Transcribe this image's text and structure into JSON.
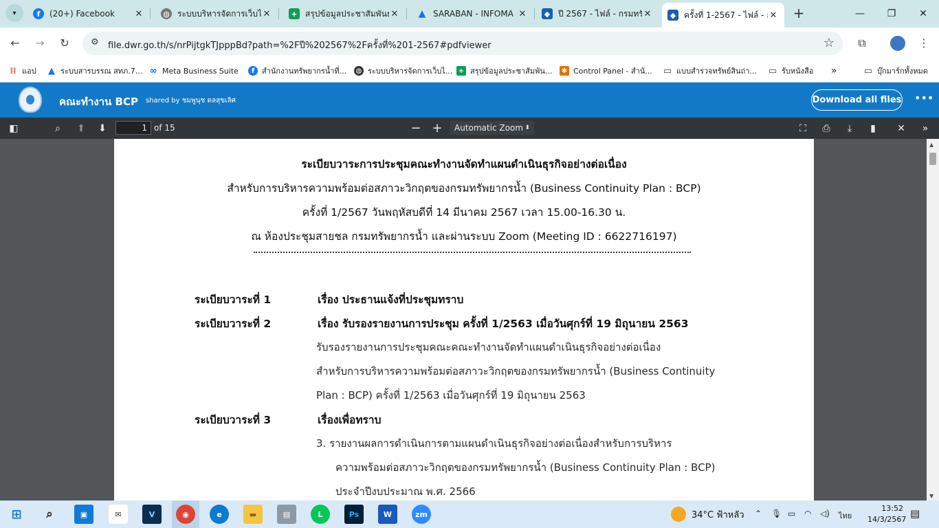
{
  "browser": {
    "tabs": [
      {
        "title": "(20+) Facebook",
        "icon": "facebook-icon",
        "color": "#1877f2"
      },
      {
        "title": "ระบบบริหารจัดการเว็บไซต์",
        "icon": "globe-icon",
        "color": "#555555"
      },
      {
        "title": "สรุปข้อมูลประชาสัมพันธ์",
        "icon": "sheets-icon",
        "color": "#0f9d58"
      },
      {
        "title": "SARABAN - INFOMA",
        "icon": "saraban-icon",
        "color": "#1a73e8"
      },
      {
        "title": "ปี 2567 - ไฟล์ - กรมทรัพย",
        "icon": "dropbox-icon",
        "color": "#1a5fb4"
      },
      {
        "title": "ครั้งที่ 1-2567 - ไฟล์ - กรม",
        "icon": "dropbox-icon",
        "color": "#1a5fb4"
      }
    ],
    "url": "file.dwr.go.th/s/nrPijtgkTJpppBd?path=%2F%E0%B8%9B%202567%2F%E0%B8%84%E0%B8%A3%E0%B8%B1%E0%B9%89%E0%B8%87%E0%B8%97%E0%B8%B5%E0%B9%88%201-2567#pdfviewer",
    "url_display": "file.dwr.go.th/s/nrPijtgkTJpppBd?path=%2Fปี%202567%2Fครั้งที่%201-2567#pdfviewer",
    "bookmarks": [
      {
        "label": "แอป",
        "icon": "apps-grid-icon",
        "color": "#ea4335"
      },
      {
        "label": "ระบบสารบรรณ สทภ.7...",
        "icon": "saraban-icon",
        "color": "#1a73e8"
      },
      {
        "label": "Meta Business Suite",
        "icon": "meta-icon",
        "color": "#0866ff"
      },
      {
        "label": "สำนักงานทรัพยากรน้ำที่...",
        "icon": "facebook-icon",
        "color": "#1877f2"
      },
      {
        "label": "ระบบบริหารจัดการเว็บไ...",
        "icon": "globe-icon",
        "color": "#333333"
      },
      {
        "label": "สรุปข้อมูลประชาสัมพัน...",
        "icon": "sheets-icon",
        "color": "#0f9d58"
      },
      {
        "label": "Control Panel - สำนั...",
        "icon": "control-panel-icon",
        "color": "#e37400"
      },
      {
        "label": "แบบสำรวจทรัพย์สินถ่า...",
        "icon": "folder-icon",
        "color": "#444444"
      },
      {
        "label": "รับหนังสือ",
        "icon": "folder-icon",
        "color": "#444444"
      },
      {
        "label": "บุ๊กมาร์กทั้งหมด",
        "icon": "folder-icon",
        "color": "#444444"
      }
    ]
  },
  "app": {
    "title": "คณะทำงาน BCP",
    "shared_by": "shared by ชมพูนุช ดลสุขเลิศ",
    "download_label": "Download all files"
  },
  "pdf": {
    "page": "1",
    "of_pages": "of 15",
    "zoom": "Automatic Zoom",
    "lines": {
      "h1": "ระเบียบวาระการประชุมคณะทำงานจัดทำแผนดำเนินธุรกิจอย่างต่อเนื่อง",
      "h2": "สำหรับการบริหารความพร้อมต่อสภาวะวิกฤตของกรมทรัพยากรน้ำ (Business Continuity Plan : BCP)",
      "h3": "ครั้งที่ 1/2567 วันพฤหัสบดีที่ 14 มีนาคม 2567 เวลา 15.00-16.30 น.",
      "h4": "ณ ห้องประชุมสายชล กรมทรัพยากรน้ำ และผ่านระบบ Zoom (Meeting ID : 6622716197)",
      "a1_label": "ระเบียบวาระที่ 1",
      "a1_text": "เรื่อง ประธานแจ้งที่ประชุมทราบ",
      "a2_label": "ระเบียบวาระที่ 2",
      "a2_text": "เรื่อง รับรองรายงานการประชุม ครั้งที่ 1/2563 เมื่อวันศุกร์ที่ 19 มิถุนายน 2563",
      "a2_b1": "รับรองรายงานการประชุมคณะคณะทำงานจัดทำแผนดำเนินธุรกิจอย่างต่อเนื่อง",
      "a2_b2": "สำหรับการบริหารความพร้อมต่อสภาวะวิกฤตของกรมทรัพยากรน้ำ (Business Continuity",
      "a2_b3": "Plan : BCP)  ครั้งที่ 1/2563 เมื่อวันศุกร์ที่ 19 มิถุนายน 2563",
      "a3_label": "ระเบียบวาระที่ 3",
      "a3_text": "เรื่องเพื่อทราบ",
      "a3_b1": "3. รายงานผลการดำเนินการตามแผนดำเนินธุรกิจอย่างต่อเนื่องสำหรับการบริหาร",
      "a3_b2": "ความพร้อมต่อสภาวะวิกฤตของกรมทรัพยากรน้ำ (Business Continuity Plan : BCP)",
      "a3_b3": "ประจำปีงบประมาณ พ.ศ. 2566"
    }
  },
  "taskbar": {
    "weather": "34°C  ฟ้าหลัว",
    "lang": "ไทย",
    "time": "13:52",
    "date": "14/3/2567"
  }
}
